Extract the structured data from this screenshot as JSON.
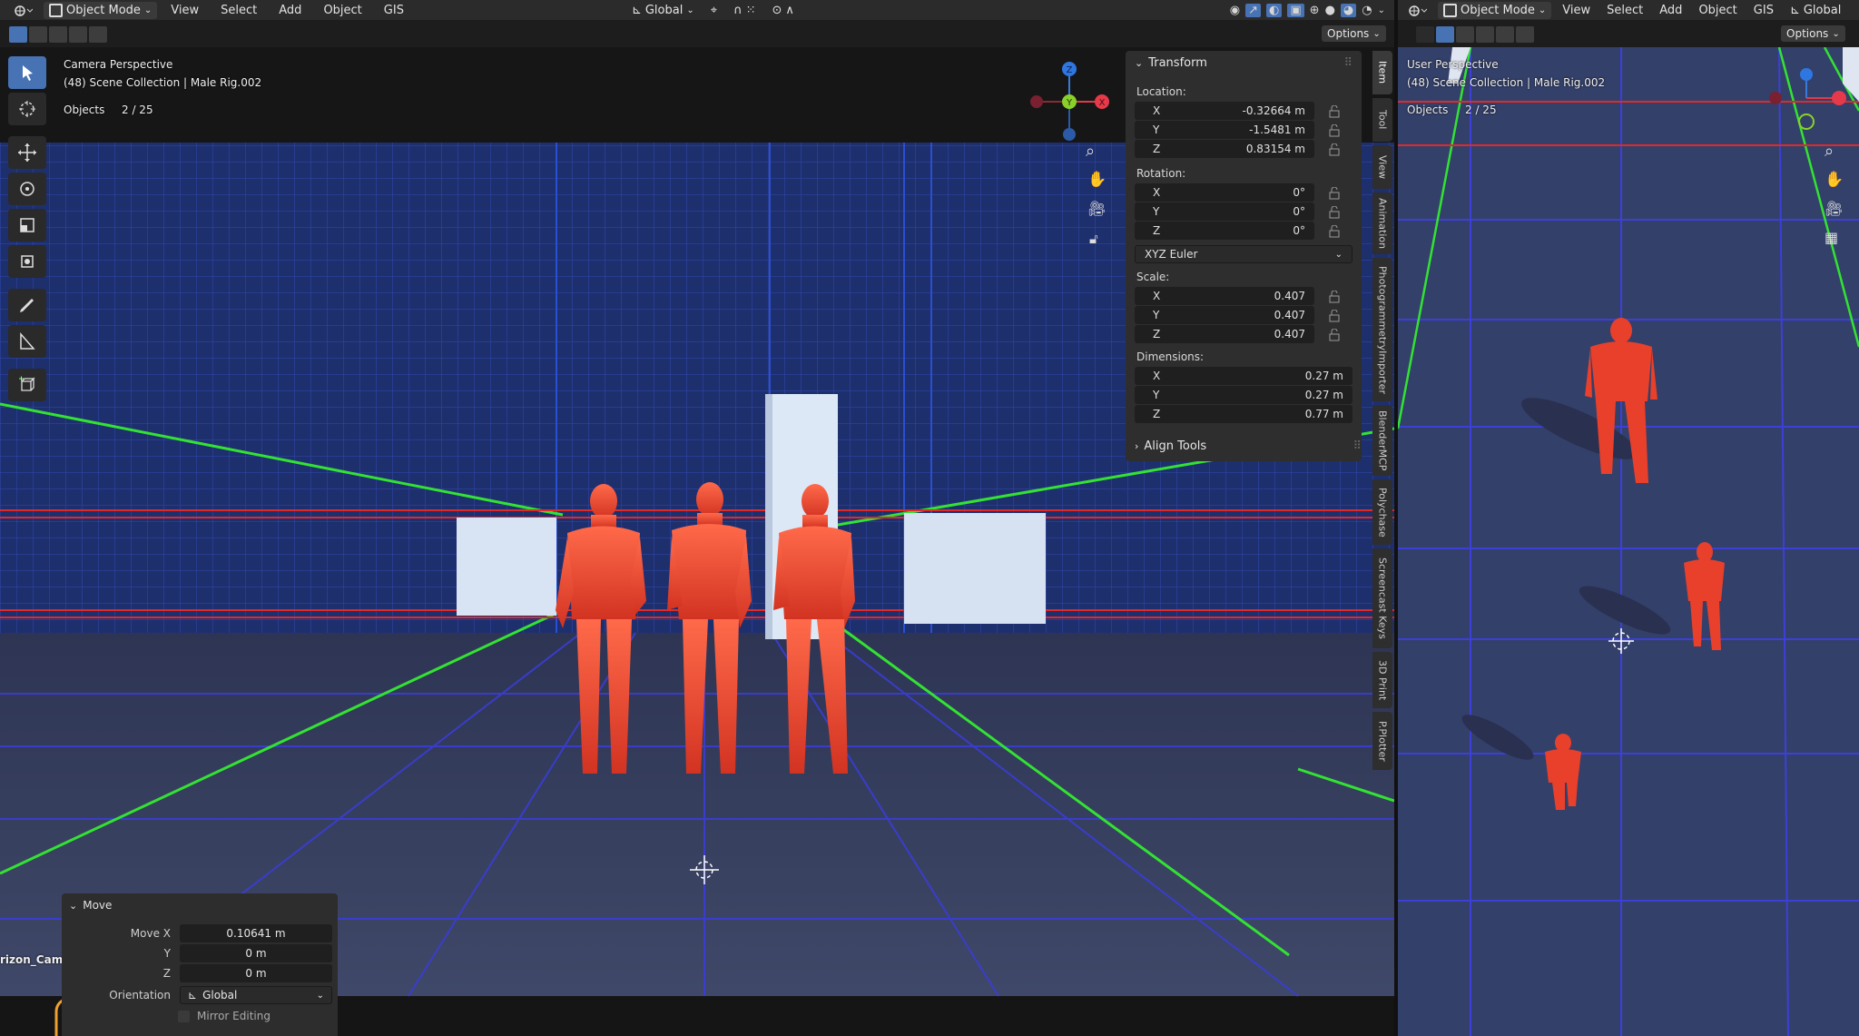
{
  "left_editor": {
    "header": {
      "mode": "Object Mode",
      "menus": [
        "View",
        "Select",
        "Add",
        "Object",
        "GIS"
      ],
      "orientation": "Global"
    },
    "options_label": "Options",
    "overlay": {
      "view_name": "Camera Perspective",
      "collection": "(48) Scene Collection | Male Rig.002",
      "objects_label": "Objects",
      "objects_count": "2 / 25"
    },
    "camera_label": "rizon_Cam",
    "gizmo": {
      "x": "X",
      "y": "Y",
      "z": "Z"
    }
  },
  "npanel": {
    "transform_title": "Transform",
    "location_label": "Location:",
    "location": [
      {
        "axis": "X",
        "value": "-0.32664 m"
      },
      {
        "axis": "Y",
        "value": "-1.5481 m"
      },
      {
        "axis": "Z",
        "value": "0.83154 m"
      }
    ],
    "rotation_label": "Rotation:",
    "rotation": [
      {
        "axis": "X",
        "value": "0°"
      },
      {
        "axis": "Y",
        "value": "0°"
      },
      {
        "axis": "Z",
        "value": "0°"
      }
    ],
    "rotation_mode": "XYZ Euler",
    "scale_label": "Scale:",
    "scale": [
      {
        "axis": "X",
        "value": "0.407"
      },
      {
        "axis": "Y",
        "value": "0.407"
      },
      {
        "axis": "Z",
        "value": "0.407"
      }
    ],
    "dimensions_label": "Dimensions:",
    "dimensions": [
      {
        "axis": "X",
        "value": "0.27 m"
      },
      {
        "axis": "Y",
        "value": "0.27 m"
      },
      {
        "axis": "Z",
        "value": "0.77 m"
      }
    ],
    "align_tools": "Align Tools"
  },
  "side_tabs": [
    "Item",
    "Tool",
    "View",
    "Animation",
    "PhotogrammetryImporter",
    "BlenderMCP",
    "Polychase",
    "Screencast Keys",
    "3D Print",
    "P.Plotter"
  ],
  "move_panel": {
    "title": "Move",
    "move_x_label": "Move X",
    "move_x": "0.10641 m",
    "y_label": "Y",
    "y": "0 m",
    "z_label": "Z",
    "z": "0 m",
    "orientation_label": "Orientation",
    "orientation": "Global",
    "mirror_label": "Mirror Editing"
  },
  "right_editor": {
    "header": {
      "mode": "Object Mode",
      "menus": [
        "View",
        "Select",
        "Add",
        "Object",
        "GIS"
      ],
      "orientation": "Global"
    },
    "options_label": "Options",
    "overlay": {
      "view_name": "User Perspective",
      "collection": "(48) Scene Collection | Male Rig.002",
      "objects_label": "Objects",
      "objects_count": "2 / 25"
    }
  },
  "colors": {
    "accent": "#4772b3",
    "figure": "#e8402a",
    "grid_blue": "#3b3df0",
    "axis_red": "#e02a2a",
    "axis_green": "#2fe02f",
    "floor": "#394266",
    "background_top": "#1c2d6a"
  }
}
